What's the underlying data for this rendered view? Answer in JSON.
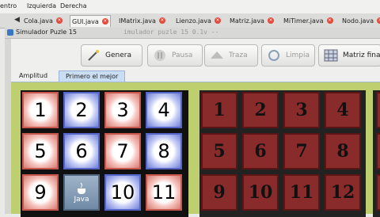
{
  "nav": {
    "items": [
      "entro",
      "Izquierda",
      "Derecha"
    ]
  },
  "editor_tabs": [
    {
      "label": "Cola.java"
    },
    {
      "label": "GUI.java"
    },
    {
      "label": "IMatrix.java"
    },
    {
      "label": "Lienzo.java"
    },
    {
      "label": "Matriz.java"
    },
    {
      "label": "MiTimer.java"
    },
    {
      "label": "Nodo.java"
    }
  ],
  "window": {
    "title": "Simulador Puzle 15",
    "ghost_title": "imulador puzle 15 0.1v --"
  },
  "toolbar": {
    "genera": "Genera",
    "pausa": "Pausa",
    "traza": "Traza",
    "limpia": "Limpia",
    "matriz": "Matriz fina"
  },
  "solver_tabs": {
    "amplitud": "Amplitud",
    "primero": "Primero el mejor"
  },
  "puzzle_left": {
    "rows": [
      [
        {
          "v": "1",
          "c": "red"
        },
        {
          "v": "2",
          "c": "blue"
        },
        {
          "v": "3",
          "c": "red"
        },
        {
          "v": "4",
          "c": "blue"
        }
      ],
      [
        {
          "v": "5",
          "c": "red"
        },
        {
          "v": "6",
          "c": "blue"
        },
        {
          "v": "7",
          "c": "red"
        },
        {
          "v": "8",
          "c": "blue"
        }
      ],
      [
        {
          "v": "9",
          "c": "red"
        },
        {
          "v": "Java",
          "c": "java"
        },
        {
          "v": "10",
          "c": "blue"
        },
        {
          "v": "11",
          "c": "red"
        }
      ]
    ]
  },
  "puzzle_right": {
    "rows": [
      [
        "1",
        "2",
        "3",
        "4"
      ],
      [
        "5",
        "6",
        "7",
        "8"
      ],
      [
        "9",
        "10",
        "11",
        "12"
      ]
    ]
  },
  "colors": {
    "board": "#bdcf6e",
    "tile_maroon": "#8a2b2b"
  }
}
